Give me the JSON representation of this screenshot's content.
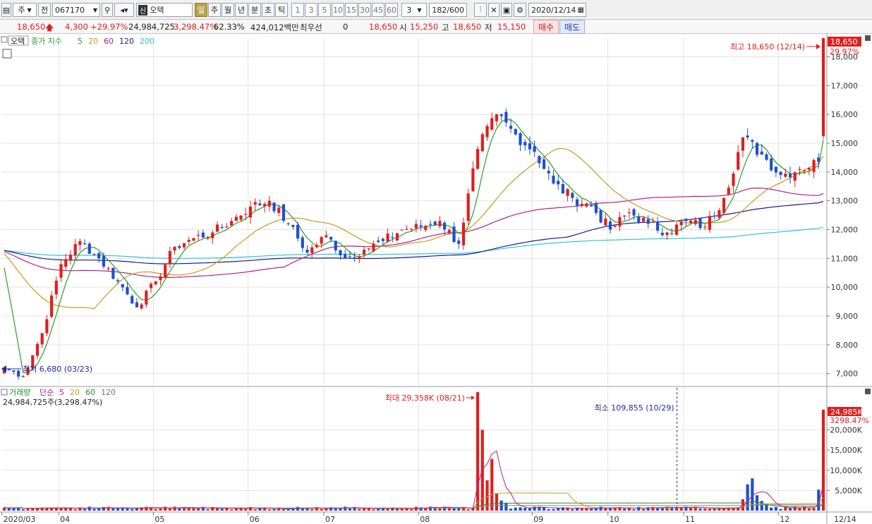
{
  "toolbar": {
    "market_type": "주",
    "prev_label": "전",
    "code": "067170",
    "market_badge": "신",
    "name": "오텍",
    "periods": [
      "일",
      "주",
      "월",
      "년",
      "분",
      "초",
      "틱"
    ],
    "selected_period": "일",
    "intervals": [
      "1",
      "3",
      "5",
      "10",
      "15",
      "30",
      "45",
      "60"
    ],
    "interval_value": "3",
    "count": "182/600",
    "date": "2020/12/14"
  },
  "quote": {
    "price": "18,650",
    "change": "4,300",
    "change_pct": "+29.97%",
    "volume": "24,984,725",
    "volume_ratio": "3,298.47%",
    "turnover_rate": "62.33%",
    "amount": "424,012백만",
    "pref_label": "최우선",
    "pref_value": "0",
    "ask_price": "18,650",
    "open_label": "시",
    "open": "15,250",
    "high_label": "고",
    "high": "18,650",
    "low_label": "저",
    "low": "15,150",
    "buy_label": "매수",
    "sell_label": "매도"
  },
  "price_panel": {
    "tab_label": "오텍",
    "legend_title": "종가 지수",
    "legend_periods": [
      "5",
      "20",
      "60",
      "120",
      "200"
    ],
    "high_annotation": "최고 18,650 (12/14)",
    "low_annotation": "최저 6,680 (03/23)",
    "current_tag": "18,650",
    "current_pct": "29.97%"
  },
  "volume_panel": {
    "legend_title": "거래량",
    "legend_type": "단순",
    "legend_periods": [
      "5",
      "20",
      "60",
      "120"
    ],
    "current_info": "24,984,725주(3,298.47%)",
    "max_annotation": "최대 29,358K (08/21)",
    "min_annotation": "최소 109,855 (10/29)",
    "current_tag": "24,985K",
    "current_pct": "3298.47%"
  },
  "colors": {
    "up": "#e01e1e",
    "down": "#1e4fd0",
    "ma5": "#2a9d2a",
    "ma20": "#c89a1e",
    "ma60": "#b0228c",
    "ma120": "#1a1a8c",
    "ma200": "#33c3d6",
    "grid": "#e3e3e3"
  },
  "chart_data": {
    "type": "candlestick",
    "price_axis": {
      "min": 6600,
      "max": 18650,
      "ticks": [
        "7,000",
        "8,000",
        "9,000",
        "10,000",
        "11,000",
        "12,000",
        "13,000",
        "14,000",
        "15,000",
        "16,000",
        "17,000",
        "18,000"
      ]
    },
    "volume_axis": {
      "min": 0,
      "max": 29358,
      "unit": "K",
      "ticks": [
        "5,000K",
        "10,000K",
        "15,000K",
        "20,000K"
      ]
    },
    "x_labels": [
      "2020/03",
      "04",
      "05",
      "06",
      "07",
      "08",
      "09",
      "10",
      "11",
      "12",
      "12/14"
    ],
    "anchors": [
      {
        "label": "03/19",
        "close": 7200
      },
      {
        "label": "03/23",
        "close": 6900
      },
      {
        "label": "03/27",
        "close": 8400
      },
      {
        "label": "04/01",
        "close": 10800
      },
      {
        "label": "04/06",
        "close": 11600
      },
      {
        "label": "04/10",
        "close": 11000
      },
      {
        "label": "04/16",
        "close": 10200
      },
      {
        "label": "04/24",
        "close": 9300
      },
      {
        "label": "05/01",
        "close": 10200
      },
      {
        "label": "05/08",
        "close": 11400
      },
      {
        "label": "05/15",
        "close": 11700
      },
      {
        "label": "05/22",
        "close": 11900
      },
      {
        "label": "05/29",
        "close": 12300
      },
      {
        "label": "06/04",
        "close": 12800
      },
      {
        "label": "06/10",
        "close": 13000
      },
      {
        "label": "06/18",
        "close": 12200
      },
      {
        "label": "06/25",
        "close": 11200
      },
      {
        "label": "07/02",
        "close": 11800
      },
      {
        "label": "07/10",
        "close": 11000
      },
      {
        "label": "07/17",
        "close": 11300
      },
      {
        "label": "07/24",
        "close": 11600
      },
      {
        "label": "07/31",
        "close": 12000
      },
      {
        "label": "08/07",
        "close": 12100
      },
      {
        "label": "08/12",
        "close": 12300
      },
      {
        "label": "08/18",
        "close": 11500
      },
      {
        "label": "08/21",
        "close": 14800
      },
      {
        "label": "08/26",
        "close": 16000
      },
      {
        "label": "08/31",
        "close": 15300
      },
      {
        "label": "09/04",
        "close": 14700
      },
      {
        "label": "09/10",
        "close": 13600
      },
      {
        "label": "09/16",
        "close": 13100
      },
      {
        "label": "09/23",
        "close": 12800
      },
      {
        "label": "10/05",
        "close": 12000
      },
      {
        "label": "10/14",
        "close": 12600
      },
      {
        "label": "10/21",
        "close": 12200
      },
      {
        "label": "10/29",
        "close": 11900
      },
      {
        "label": "11/05",
        "close": 12300
      },
      {
        "label": "11/12",
        "close": 12100
      },
      {
        "label": "11/18",
        "close": 13100
      },
      {
        "label": "11/23",
        "close": 15200
      },
      {
        "label": "11/26",
        "close": 14600
      },
      {
        "label": "12/01",
        "close": 13900
      },
      {
        "label": "12/07",
        "close": 14100
      },
      {
        "label": "12/11",
        "close": 14350
      },
      {
        "label": "12/14",
        "close": 18650
      }
    ]
  }
}
